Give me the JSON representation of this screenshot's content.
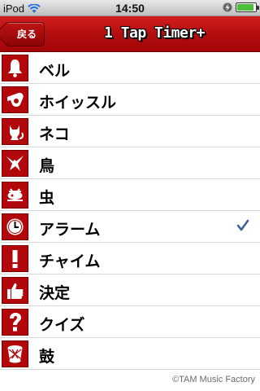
{
  "status_bar": {
    "carrier": "iPod",
    "time": "14:50",
    "battery_level": 0.9
  },
  "nav": {
    "back_label": "戻る",
    "title": "1 Tap Timer+"
  },
  "colors": {
    "nav_red": "#b30e10",
    "icon_red": "#b3080b",
    "checkmark_blue": "#3b5d9c"
  },
  "list": {
    "items": [
      {
        "label": "ベル",
        "icon": "bell-icon",
        "selected": false
      },
      {
        "label": "ホイッスル",
        "icon": "whistle-icon",
        "selected": false
      },
      {
        "label": "ネコ",
        "icon": "cat-icon",
        "selected": false
      },
      {
        "label": "鳥",
        "icon": "bird-icon",
        "selected": false
      },
      {
        "label": "虫",
        "icon": "bug-icon",
        "selected": false
      },
      {
        "label": "アラーム",
        "icon": "alarm-clock-icon",
        "selected": true
      },
      {
        "label": "チャイム",
        "icon": "exclamation-icon",
        "selected": false
      },
      {
        "label": "決定",
        "icon": "thumbs-up-icon",
        "selected": false
      },
      {
        "label": "クイズ",
        "icon": "question-icon",
        "selected": false
      },
      {
        "label": "鼓",
        "icon": "drum-icon",
        "selected": false
      }
    ]
  },
  "footer": {
    "credit": "©TAM Music Factory"
  }
}
